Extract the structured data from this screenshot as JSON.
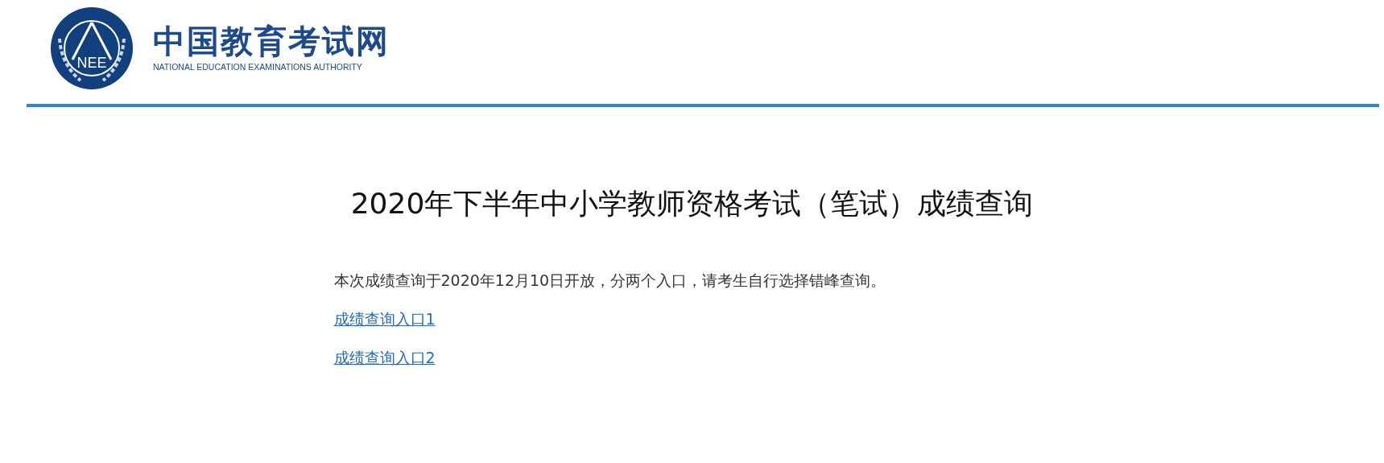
{
  "header": {
    "logo_mark": "NEE",
    "site_name": "中国教育考试网",
    "site_name_en": "NATIONAL EDUCATION EXAMINATIONS AUTHORITY"
  },
  "title": "2020年下半年中小学教师资格考试（笔试）成绩查询",
  "notice": "本次成绩查询于2020年12月10日开放，分两个入口，请考生自行选择错峰查询。",
  "links": [
    {
      "label": "成绩查询入口1"
    },
    {
      "label": "成绩查询入口2"
    }
  ]
}
